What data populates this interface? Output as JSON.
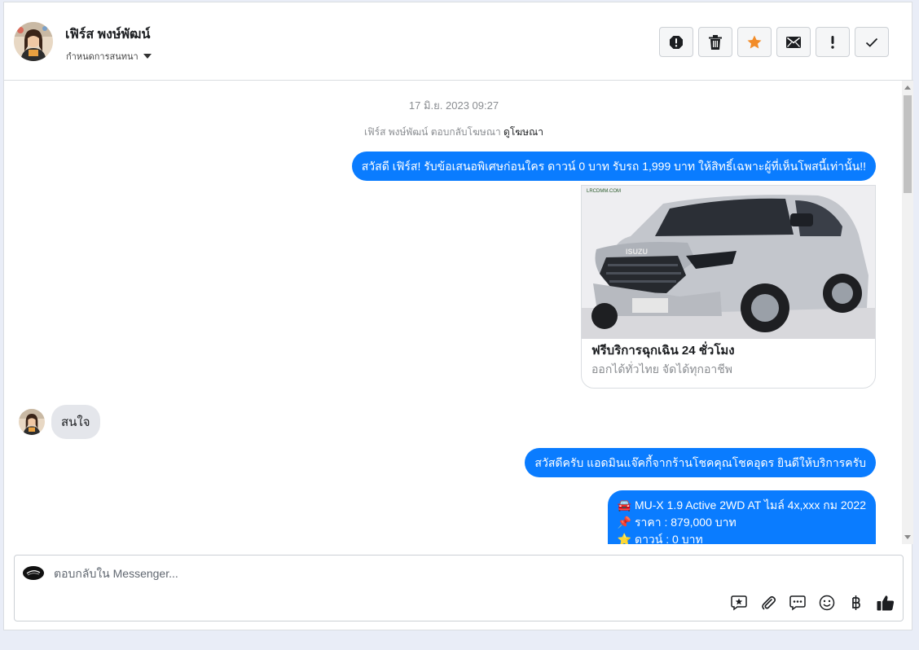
{
  "header": {
    "name": "เฟิร์ส พงษ์พัฒน์",
    "assign_label": "กำหนดการสนทนา",
    "tools": [
      {
        "name": "spam-report",
        "icon": "alert-octagon-icon"
      },
      {
        "name": "delete",
        "icon": "trash-icon"
      },
      {
        "name": "star",
        "icon": "star-icon",
        "color": "#f28c28"
      },
      {
        "name": "mark-unread",
        "icon": "envelope-icon"
      },
      {
        "name": "follow-up",
        "icon": "exclamation-icon"
      },
      {
        "name": "mark-done",
        "icon": "checkmark-icon"
      }
    ]
  },
  "thread": {
    "timestamp": "17 มิ.ย. 2023 09:27",
    "ad_reply_text": "เฟิร์ส พงษ์พัฒน์ ตอบกลับโฆษณา",
    "ad_reply_link": "ดูโฆษณา",
    "messages": [
      {
        "from": "page",
        "text": "สวัสดี เฟิร์ส! รับข้อเสนอพิเศษก่อนใคร ดาวน์ 0 บาท รับรถ 1,999 บาท ให้สิทธิ์เฉพาะผู้ที่เห็นโพสนี้เท่านั้น!!"
      },
      {
        "from": "page",
        "card": {
          "image_logo_text": "LRCDMM.COM",
          "image_brand": "ISUZU",
          "title": "ฟรีบริการฉุกเฉิน 24 ชั่วโมง",
          "subtitle": "ออกได้ทั่วไทย จัดได้ทุกอาชีพ"
        }
      },
      {
        "from": "user",
        "text": "สนใจ"
      },
      {
        "from": "page",
        "text": "สวัสดีครับ แอดมินแจ๊คกี้จากร้านโชคคุณโชคอุดร ยินดีให้บริการครับ"
      },
      {
        "from": "page",
        "lines": [
          "🚘 MU-X 1.9 Active 2WD AT ไมล์ 4x,xxx กม 2022",
          "📌 ราคา : 879,000 บาท",
          "⭐ ดาวน์ : 0 บาท"
        ]
      }
    ]
  },
  "composer": {
    "placeholder": "ตอบกลับใน Messenger...",
    "tools": [
      "saved-reply-icon",
      "attachment-icon",
      "chat-icon",
      "emoji-icon",
      "baht-icon",
      "thumbs-up-icon"
    ]
  },
  "colors": {
    "accent": "#0a7cff",
    "incoming_bubble": "#e4e6eb",
    "star": "#f28c28"
  }
}
